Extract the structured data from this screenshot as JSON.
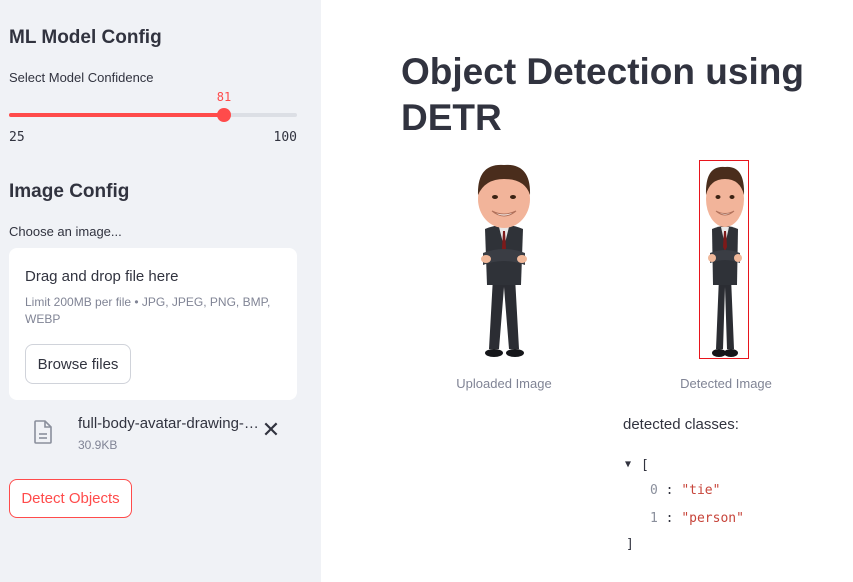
{
  "sidebar": {
    "model_config_heading": "ML Model Config",
    "confidence_label": "Select Model Confidence",
    "slider": {
      "value": 81,
      "min": 25,
      "max": 100,
      "value_label": "81",
      "min_label": "25",
      "max_label": "100"
    },
    "image_config_heading": "Image Config",
    "choose_label": "Choose an image...",
    "dropzone": {
      "title": "Drag and drop file here",
      "limit": "Limit 200MB per file • JPG, JPEG, PNG, BMP, WEBP",
      "browse_label": "Browse files"
    },
    "file": {
      "name": "full-body-avatar-drawing-vector.jpg",
      "size": "30.9KB",
      "icon": "file-icon",
      "remove": "✕"
    },
    "detect_label": "Detect Objects"
  },
  "main": {
    "title": "Object Detection using DETR",
    "uploaded_caption": "Uploaded Image",
    "detected_caption": "Detected Image",
    "detected_label": "detected classes:",
    "json": {
      "open": "[",
      "close": "]",
      "items": [
        {
          "index": "0",
          "value": "\"tie\""
        },
        {
          "index": "1",
          "value": "\"person\""
        }
      ]
    }
  },
  "colors": {
    "accent": "#ff4b4b",
    "sidebar_bg": "#f0f2f6",
    "bbox": "#e8141c"
  }
}
